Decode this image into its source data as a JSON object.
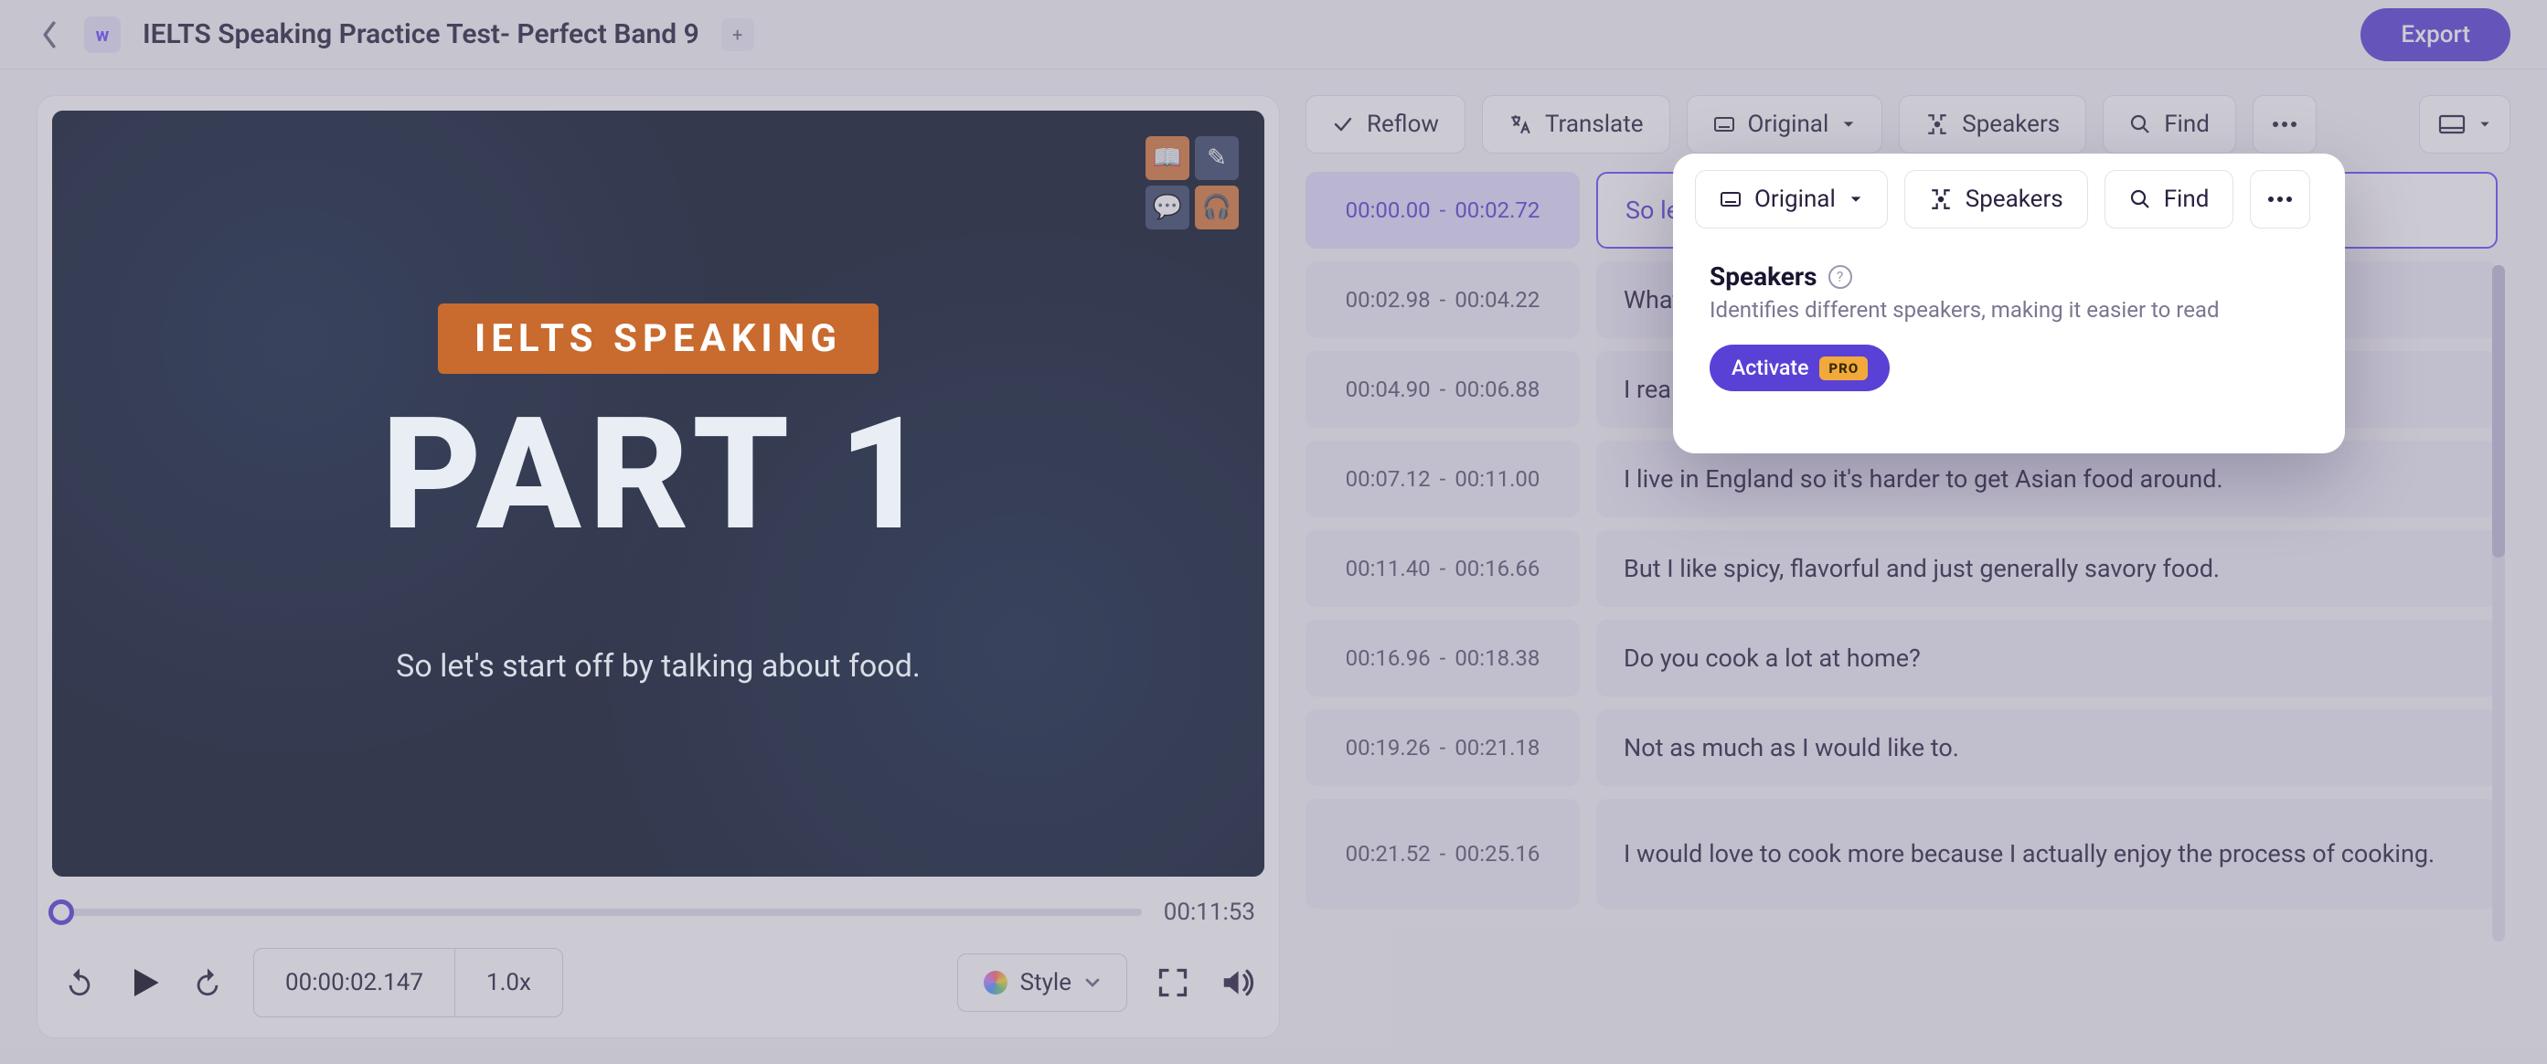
{
  "header": {
    "title": "IELTS Speaking Practice Test- Perfect Band 9",
    "export_label": "Export",
    "logo_letter": "w"
  },
  "video": {
    "ielts_label": "IELTS SPEAKING",
    "part_label": "PART 1",
    "caption": "So let's start off by talking about food.",
    "duration": "00:11:53",
    "current_time": "00:00:02.147",
    "speed": "1.0x",
    "style_label": "Style"
  },
  "toolbar": {
    "reflow": "Reflow",
    "translate": "Translate",
    "original": "Original",
    "speakers": "Speakers",
    "find": "Find"
  },
  "transcript": [
    {
      "start": "00:00.00",
      "end": "00:02.72",
      "text": "So let",
      "active": true
    },
    {
      "start": "00:02.98",
      "end": "00:04.22",
      "text": "What'"
    },
    {
      "start": "00:04.90",
      "end": "00:06.88",
      "text": "I really love Asian food."
    },
    {
      "start": "00:07.12",
      "end": "00:11.00",
      "text": "I live in England so it's harder to get Asian food around."
    },
    {
      "start": "00:11.40",
      "end": "00:16.66",
      "text": "But I like spicy, flavorful and just generally savory food."
    },
    {
      "start": "00:16.96",
      "end": "00:18.38",
      "text": "Do you cook a lot at home?"
    },
    {
      "start": "00:19.26",
      "end": "00:21.18",
      "text": "Not as much as I would like to."
    },
    {
      "start": "00:21.52",
      "end": "00:25.16",
      "text": "I would love to cook more because I actually enjoy the process of cooking.",
      "tall": true
    }
  ],
  "popover": {
    "title": "Speakers",
    "desc": "Identifies different speakers, making it easier to read",
    "activate": "Activate",
    "pro": "PRO",
    "buttons": {
      "original": "Original",
      "speakers": "Speakers",
      "find": "Find"
    }
  }
}
